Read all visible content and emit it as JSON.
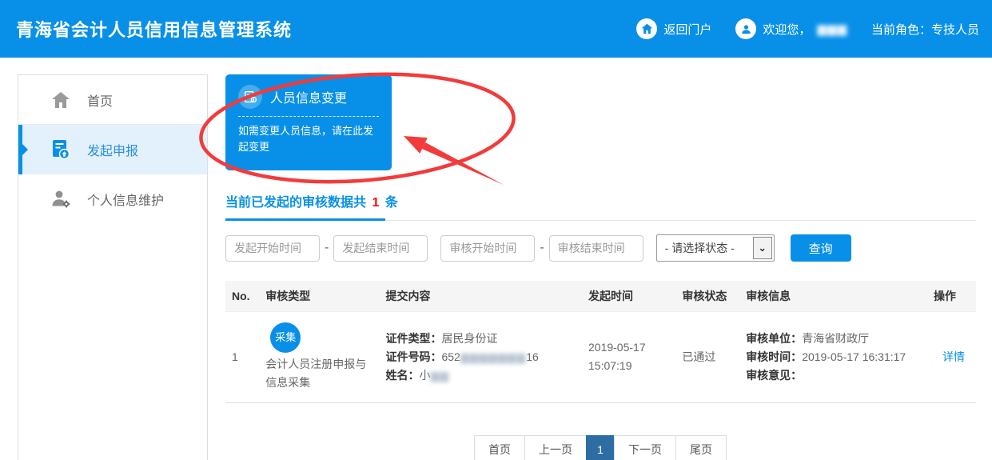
{
  "header": {
    "title": "青海省会计人员信用信息管理系统",
    "return_portal": "返回门户",
    "welcome_prefix": "欢迎您，",
    "welcome_name_masked": "▆▆▆",
    "role_label": "当前角色：专技人员"
  },
  "sidebar": {
    "items": [
      {
        "label": "首页",
        "icon": "home-icon",
        "active": false
      },
      {
        "label": "发起申报",
        "icon": "declare-icon",
        "active": true
      },
      {
        "label": "个人信息维护",
        "icon": "profile-maintenance-icon",
        "active": false
      }
    ]
  },
  "card": {
    "title": "人员信息变更",
    "description": "如需变更人员信息，请在此发起变更"
  },
  "section": {
    "heading_prefix": "当前已发起的审核数据共",
    "count": "1",
    "heading_suffix": "条"
  },
  "filters": {
    "placeholders": [
      "发起开始时间",
      "发起结束时间",
      "审核开始时间",
      "审核结束时间"
    ],
    "separator": "-",
    "status_value": "- 请选择状态 -",
    "select_arrow": "⌄",
    "query_button": "查询"
  },
  "table": {
    "headers": [
      "No.",
      "审核类型",
      "提交内容",
      "发起时间",
      "审核状态",
      "审核信息",
      "操作"
    ],
    "rows": [
      {
        "no": "1",
        "type_badge": "采集",
        "type_text": "会计人员注册申报与信息采集",
        "submit": {
          "doc_type_label": "证件类型：",
          "doc_type": "居民身份证",
          "doc_no_label": "证件号码：",
          "doc_no_prefix": "652",
          "doc_no_masked": "▆▆▆▆▆▆▆",
          "doc_no_suffix": "16",
          "name_label": "姓名：",
          "name_prefix": "小",
          "name_masked": "▆▆"
        },
        "initiated_at": "2019-05-17 15:07:19",
        "status": "已通过",
        "review": {
          "unit_label": "审核单位：",
          "unit": "青海省财政厅",
          "time_label": "审核时间：",
          "time": "2019-05-17 16:31:17",
          "opinion_label": "审核意见：",
          "opinion": ""
        },
        "action": "详情"
      }
    ]
  },
  "pagination": {
    "items": [
      "首页",
      "上一页",
      "1",
      "下一页",
      "尾页"
    ],
    "active": "1"
  },
  "colors": {
    "primary": "#0890e8",
    "sidebar_active_bg": "#e3f1fd",
    "active_page": "#2d6da3",
    "annotation_red": "#f23b3b",
    "count_red": "#f10b0b",
    "table_header_bg": "#f5f5f5"
  }
}
